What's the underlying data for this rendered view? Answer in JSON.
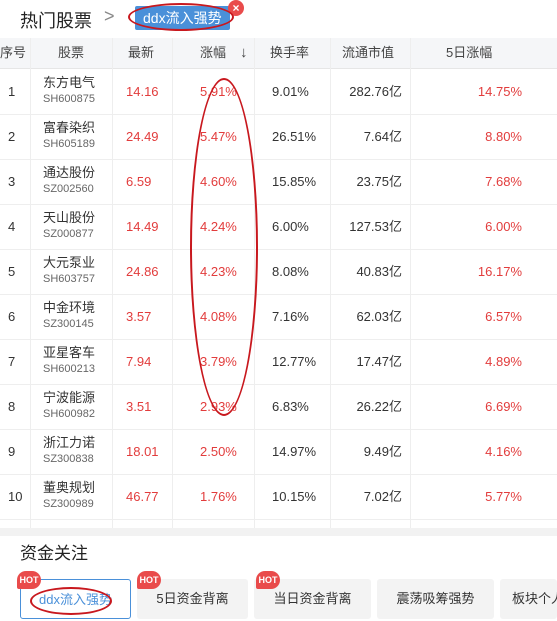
{
  "header": {
    "title": "热门股票",
    "chevron_icon": "chevron-right-icon",
    "active_tag": "ddx流入强势",
    "tag_close_glyph": "×"
  },
  "table": {
    "columns": {
      "index": "序号",
      "stock": "股票",
      "price": "最新",
      "change": "涨幅",
      "sort_arrow": "↓",
      "turnover": "换手率",
      "mktcap": "流通市值",
      "change5d": "5日涨幅"
    },
    "rows": [
      {
        "idx": "1",
        "name": "东方电气",
        "code": "SH600875",
        "price": "14.16",
        "change": "5.91%",
        "turnover": "9.01%",
        "mktcap": "282.76亿",
        "change5d": "14.75%"
      },
      {
        "idx": "2",
        "name": "富春染织",
        "code": "SH605189",
        "price": "24.49",
        "change": "5.47%",
        "turnover": "26.51%",
        "mktcap": "7.64亿",
        "change5d": "8.80%"
      },
      {
        "idx": "3",
        "name": "通达股份",
        "code": "SZ002560",
        "price": "6.59",
        "change": "4.60%",
        "turnover": "15.85%",
        "mktcap": "23.75亿",
        "change5d": "7.68%"
      },
      {
        "idx": "4",
        "name": "天山股份",
        "code": "SZ000877",
        "price": "14.49",
        "change": "4.24%",
        "turnover": "6.00%",
        "mktcap": "127.53亿",
        "change5d": "6.00%"
      },
      {
        "idx": "5",
        "name": "大元泵业",
        "code": "SH603757",
        "price": "24.86",
        "change": "4.23%",
        "turnover": "8.08%",
        "mktcap": "40.83亿",
        "change5d": "16.17%"
      },
      {
        "idx": "6",
        "name": "中金环境",
        "code": "SZ300145",
        "price": "3.57",
        "change": "4.08%",
        "turnover": "7.16%",
        "mktcap": "62.03亿",
        "change5d": "6.57%"
      },
      {
        "idx": "7",
        "name": "亚星客车",
        "code": "SH600213",
        "price": "7.94",
        "change": "3.79%",
        "turnover": "12.77%",
        "mktcap": "17.47亿",
        "change5d": "4.89%"
      },
      {
        "idx": "8",
        "name": "宁波能源",
        "code": "SH600982",
        "price": "3.51",
        "change": "2.93%",
        "turnover": "6.83%",
        "mktcap": "26.22亿",
        "change5d": "6.69%"
      },
      {
        "idx": "9",
        "name": "浙江力诺",
        "code": "SZ300838",
        "price": "18.01",
        "change": "2.50%",
        "turnover": "14.97%",
        "mktcap": "9.49亿",
        "change5d": "4.16%"
      },
      {
        "idx": "10",
        "name": "董奥规划",
        "code": "SZ300989",
        "price": "46.77",
        "change": "1.76%",
        "turnover": "10.15%",
        "mktcap": "7.02亿",
        "change5d": "5.77%"
      }
    ]
  },
  "funds": {
    "title": "资金关注",
    "hot_label": "HOT",
    "buttons": [
      {
        "label": "ddx流入强势"
      },
      {
        "label": "5日资金背离"
      },
      {
        "label": "当日资金背离"
      },
      {
        "label": "震荡吸筹强势"
      },
      {
        "label": "板块个人"
      }
    ]
  },
  "colors": {
    "up": "#e23c3c",
    "accent": "#4a90d9",
    "annotation": "#c8181e"
  }
}
